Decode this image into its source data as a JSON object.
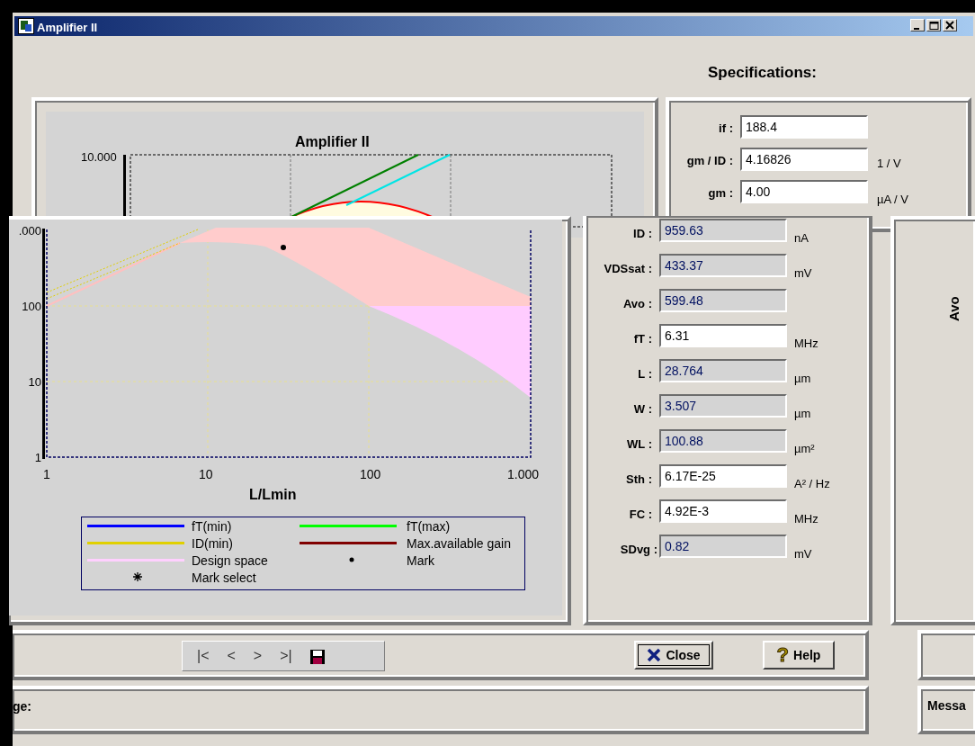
{
  "window": {
    "title": "Amplifier II"
  },
  "specifications_heading": "Specifications:",
  "upper_chart": {
    "title": "Amplifier II",
    "ytick": "10.000"
  },
  "spec_fields": [
    {
      "label": "if :",
      "value": "188.4",
      "editable": true
    },
    {
      "label": "gm / ID :",
      "value": "4.16826",
      "unit": "1 / V",
      "editable": true
    },
    {
      "label": "gm :",
      "value": "4.00",
      "unit": "µA / V",
      "editable": true
    }
  ],
  "result_fields": [
    {
      "label": "ID :",
      "value": "959.63",
      "unit": "nA",
      "editable": false
    },
    {
      "label": "VDSsat :",
      "value": "433.37",
      "unit": "mV",
      "editable": false
    },
    {
      "label": "Avo :",
      "value": "599.48",
      "editable": false
    },
    {
      "label": "fT :",
      "value": "6.31",
      "unit": "MHz",
      "editable": true
    },
    {
      "label": "L :",
      "value": "28.764",
      "unit": "µm",
      "editable": false
    },
    {
      "label": "W :",
      "value": "3.507",
      "unit": "µm",
      "editable": false
    },
    {
      "label": "WL :",
      "value": "100.88",
      "unit": "µm²",
      "editable": false
    },
    {
      "label": "Sth :",
      "value": "6.17E-25",
      "unit": "A² / Hz",
      "editable": true
    },
    {
      "label": "FC :",
      "value": "4.92E-3",
      "unit": "MHz",
      "editable": true
    },
    {
      "label": "SDvg :",
      "value": "0.82",
      "unit": "mV",
      "editable": false
    }
  ],
  "plot": {
    "yticks": [
      ".000",
      "100",
      "10",
      "1"
    ],
    "xticks": [
      "1",
      "10",
      "100",
      "1.000"
    ],
    "xlabel": "L/Lmin",
    "legend": [
      {
        "label": "fT(min)",
        "kind": "line",
        "color": "#0000ff"
      },
      {
        "label": "fT(max)",
        "kind": "line",
        "color": "#00ff00"
      },
      {
        "label": "ID(min)",
        "kind": "line",
        "color": "#e0d000"
      },
      {
        "label": "Max.available gain",
        "kind": "line",
        "color": "#800000"
      },
      {
        "label": "Design space",
        "kind": "line",
        "color": "#ffd0ff"
      },
      {
        "label": "Mark",
        "kind": "dot",
        "color": "#000000"
      },
      {
        "label": "Mark select",
        "kind": "star",
        "color": "#000000"
      }
    ]
  },
  "side_panel": {
    "label": "Avo"
  },
  "nav_buttons": [
    "|<",
    "<",
    ">",
    ">|"
  ],
  "buttons": [
    {
      "kind": "close",
      "label": "Close"
    },
    {
      "kind": "help",
      "icon": "?",
      "label": "Help"
    }
  ],
  "message": {
    "label": "ge:"
  },
  "side_message": {
    "label": "Messa"
  }
}
